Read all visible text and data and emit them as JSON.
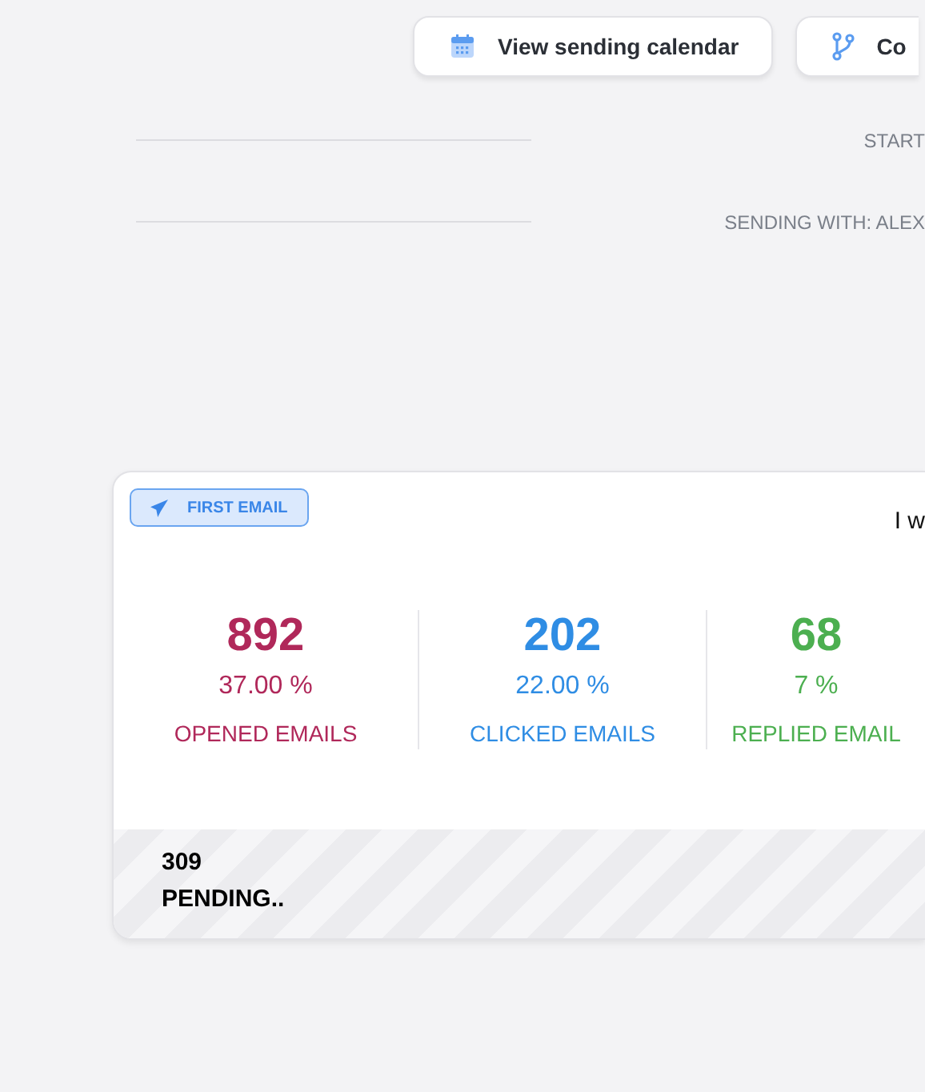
{
  "toolbar": {
    "buttons": [
      {
        "label": "View sending calendar",
        "kind": "calendar"
      },
      {
        "label": "Co",
        "kind": "branch"
      }
    ]
  },
  "info_rows": [
    {
      "label": "START"
    },
    {
      "label": "SENDING WITH: ALEX"
    }
  ],
  "step_card": {
    "badge": "FIRST EMAIL",
    "header_text": "I w",
    "stats": [
      {
        "value": "892",
        "percent": "37.00 %",
        "label": "OPENED EMAILS",
        "color": "#b0285a"
      },
      {
        "value": "202",
        "percent": "22.00 %",
        "label": "CLICKED EMAILS",
        "color": "#2f8de4"
      },
      {
        "value": "68",
        "percent": "7 %",
        "label": "REPLIED EMAIL",
        "color": "#4caf50"
      }
    ],
    "pending": {
      "count": "309",
      "label": "PENDING.."
    }
  }
}
